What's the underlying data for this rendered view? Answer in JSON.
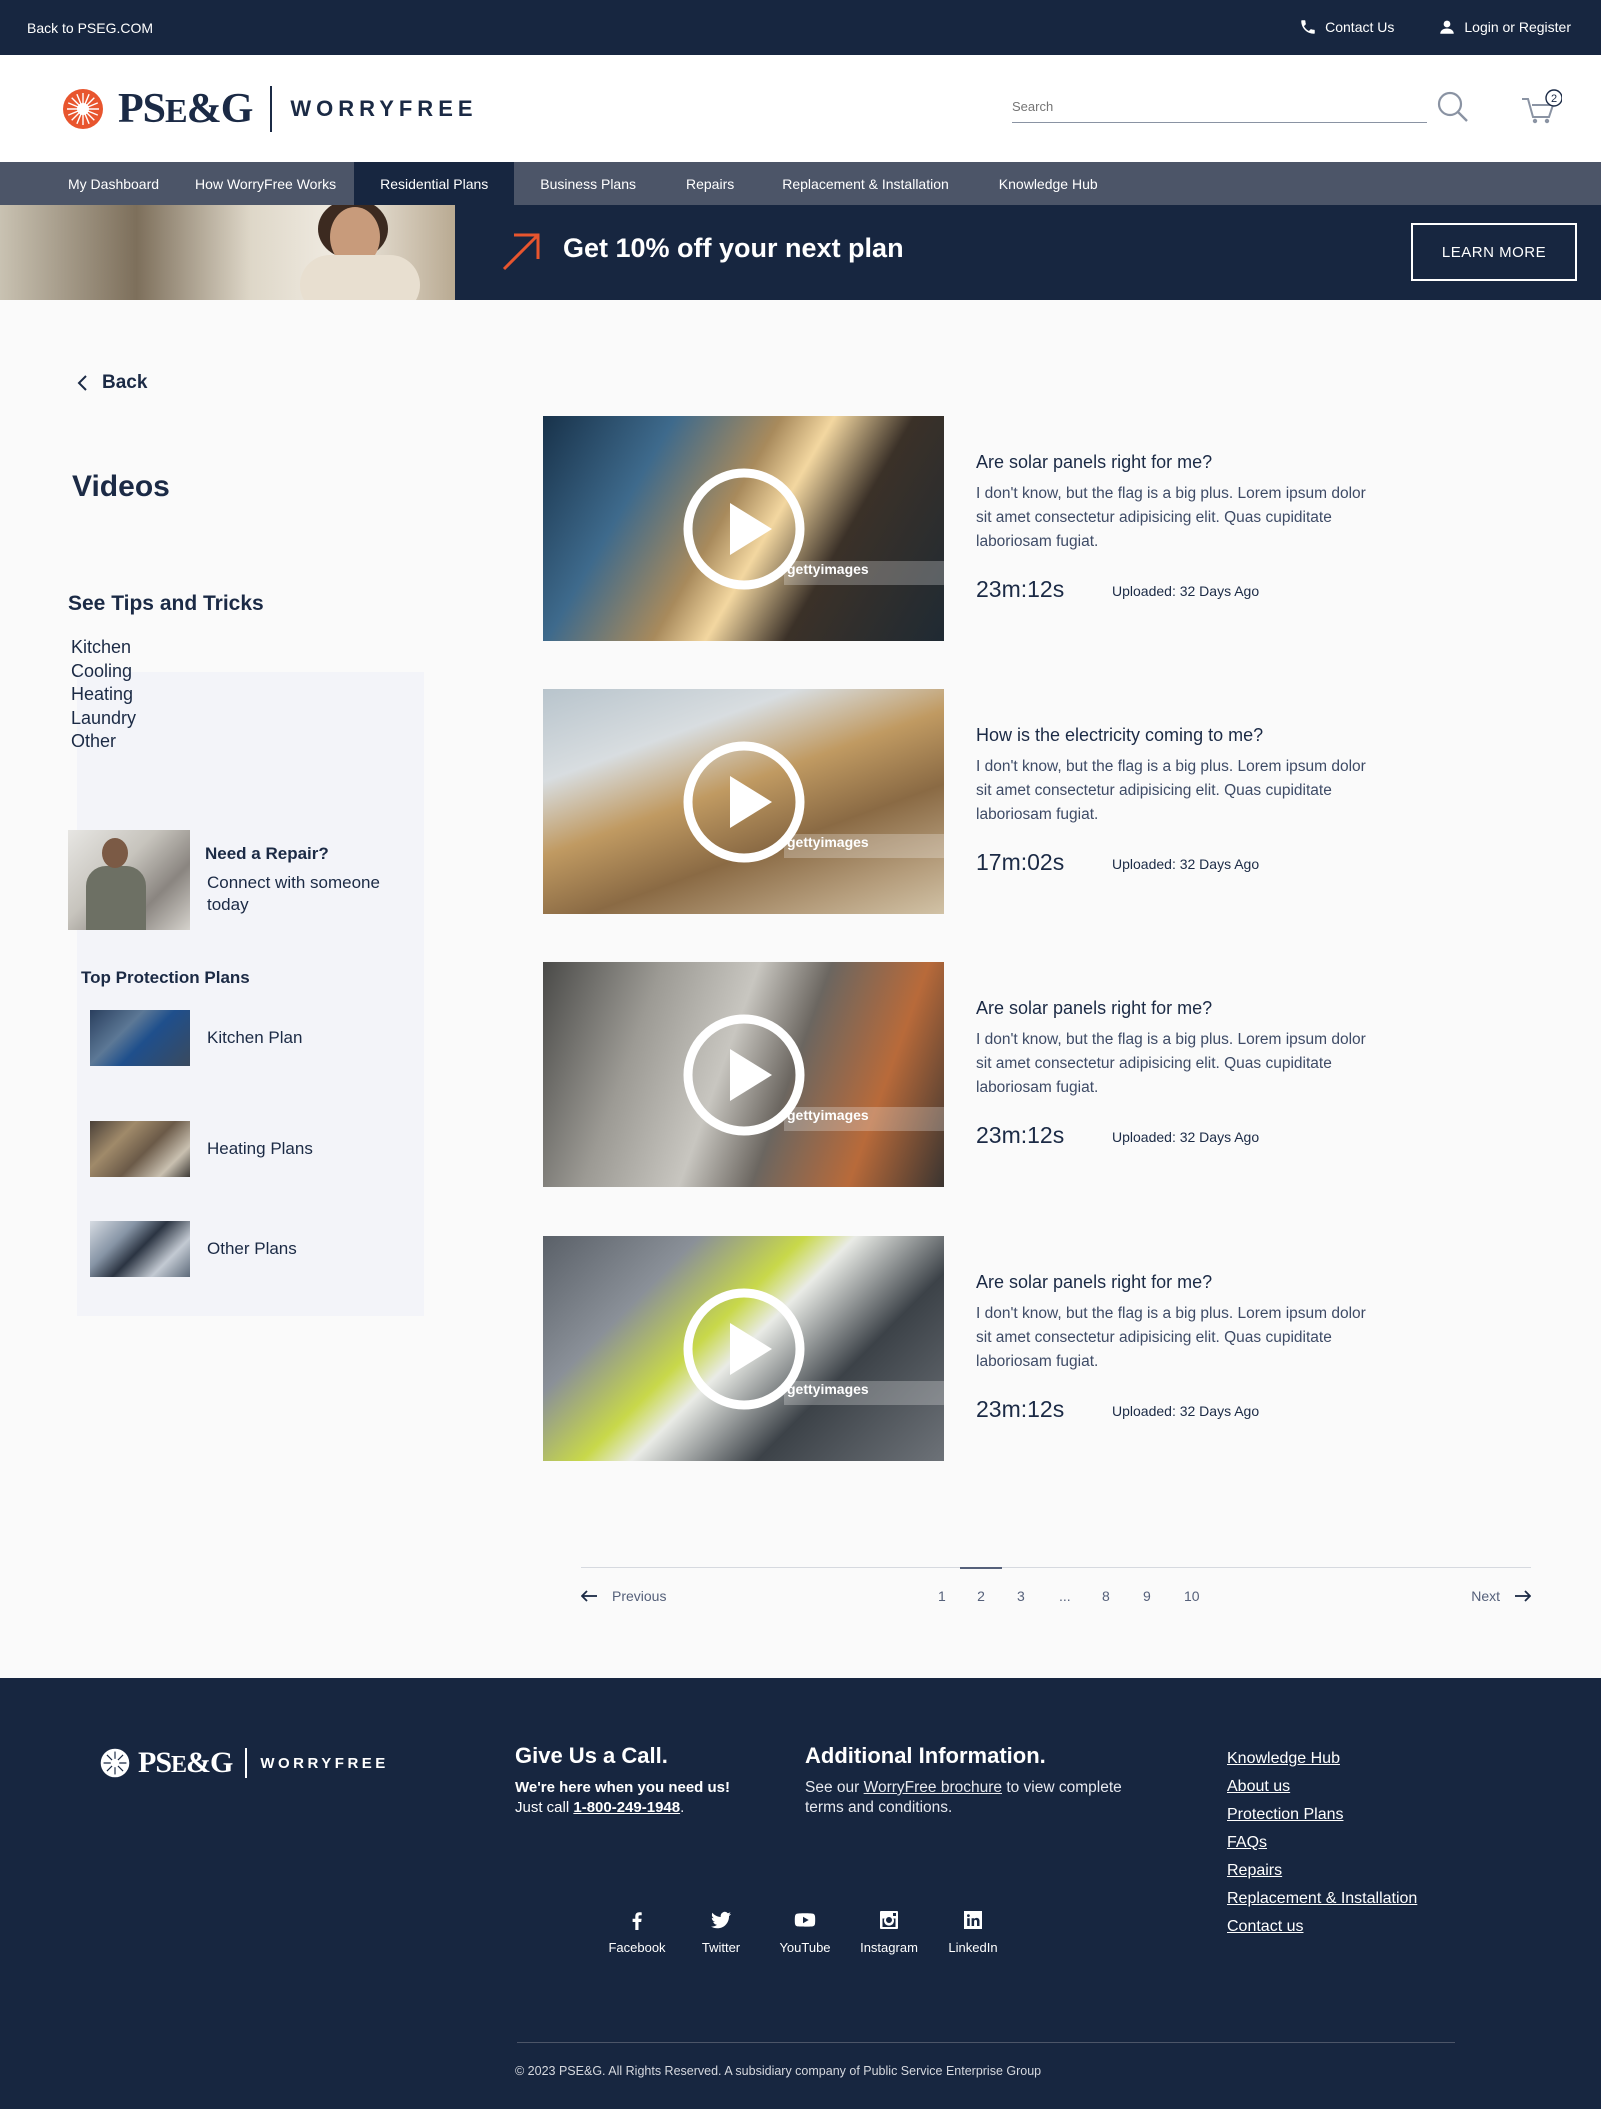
{
  "utility": {
    "back": "Back to PSEG.COM",
    "contact": "Contact Us",
    "login": "Login or Register"
  },
  "header": {
    "brand": "PSEG",
    "product": "WORRYFREE",
    "search_placeholder": "Search",
    "cart_count": "2"
  },
  "nav": {
    "items": [
      "My Dashboard",
      "How WorryFree Works",
      "Residential Plans",
      "Business Plans",
      "Repairs",
      "Replacement & Installation",
      "Knowledge Hub"
    ],
    "active": "Residential Plans"
  },
  "promo": {
    "headline": "Get 10% off your next plan",
    "button": "LEARN MORE"
  },
  "sidebar": {
    "back": "Back",
    "title": "Videos",
    "tips_title": "See Tips and Tricks",
    "tips": [
      "Kitchen",
      "Cooling",
      "Heating",
      "Laundry",
      "Other"
    ],
    "repair_title": "Need a Repair?",
    "repair_text": "Connect with someone today",
    "plans_title": "Top Protection Plans",
    "plans": [
      "Kitchen Plan",
      "Heating Plans",
      "Other Plans"
    ]
  },
  "videos": [
    {
      "title": "Are solar panels right for me?",
      "description": "I don't know, but the flag is a big plus. Lorem ipsum dolor sit amet consectetur adipisicing elit. Quas cupiditate laboriosam fugiat.",
      "duration": "23m:12s",
      "uploaded": "Uploaded: 32 Days Ago"
    },
    {
      "title": "How is the electricity coming to me?",
      "description": "I don't know, but the flag is a big plus. Lorem ipsum dolor sit amet consectetur adipisicing elit. Quas cupiditate laboriosam fugiat.",
      "duration": "17m:02s",
      "uploaded": "Uploaded: 32 Days Ago"
    },
    {
      "title": "Are solar panels right for me?",
      "description": "I don't know, but the flag is a big plus. Lorem ipsum dolor sit amet consectetur adipisicing elit. Quas cupiditate laboriosam fugiat.",
      "duration": "23m:12s",
      "uploaded": "Uploaded: 32 Days Ago"
    },
    {
      "title": "Are solar panels right for me?",
      "description": "I don't know, but the flag is a big plus. Lorem ipsum dolor sit amet consectetur adipisicing elit. Quas cupiditate laboriosam fugiat.",
      "duration": "23m:12s",
      "uploaded": "Uploaded: 32 Days Ago"
    }
  ],
  "video_watermark": "gettyimages",
  "pagination": {
    "previous": "Previous",
    "next": "Next",
    "pages": [
      "1",
      "2",
      "3",
      "...",
      "8",
      "9",
      "10"
    ],
    "current": "2"
  },
  "footer": {
    "brand": "PSEG",
    "product": "WORRYFREE",
    "call_title": "Give Us a Call.",
    "call_line1": "We're here when you need us!",
    "call_prefix": "Just call",
    "call_phone": "1-800-249-1948",
    "call_suffix": ".",
    "info_title": "Additional Information.",
    "info_prefix": "See our",
    "info_link": "WorryFree brochure",
    "info_suffix": "to view complete terms and conditions.",
    "links": [
      "Knowledge Hub",
      "About us",
      "Protection Plans",
      "FAQs",
      "Repairs",
      "Replacement & Installation",
      "Contact us"
    ],
    "social": [
      "Facebook",
      "Twitter",
      "YouTube",
      "Instagram",
      "LinkedIn"
    ],
    "copyright": "© 2023 PSE&G. All Rights Reserved. A subsidiary company of Public Service Enterprise Group"
  },
  "colors": {
    "navy": "#172640",
    "nav_gray": "#4c5568",
    "accent_orange": "#e8552e"
  }
}
